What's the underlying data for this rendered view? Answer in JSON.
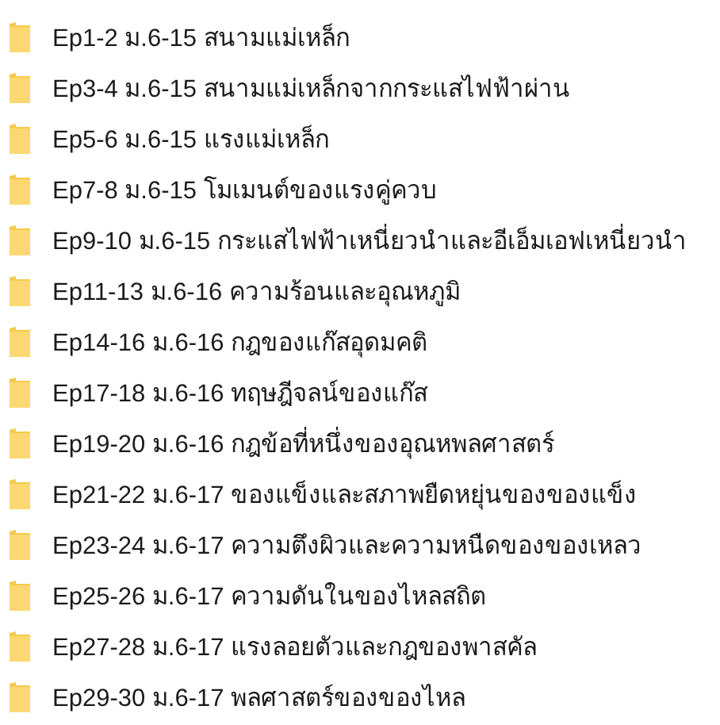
{
  "folders": [
    {
      "name": "Ep1-2 ม.6-15 สนามแม่เหล็ก"
    },
    {
      "name": "Ep3-4 ม.6-15 สนามแม่เหล็กจากกระแสไฟฟ้าผ่าน"
    },
    {
      "name": "Ep5-6 ม.6-15 แรงแม่เหล็ก"
    },
    {
      "name": "Ep7-8 ม.6-15 โมเมนต์ของแรงคู่ควบ"
    },
    {
      "name": "Ep9-10 ม.6-15 กระแสไฟฟ้าเหนี่ยวนำและอีเอ็มเอฟเหนี่ยวนำ"
    },
    {
      "name": "Ep11-13 ม.6-16 ความร้อนและอุณหภูมิ"
    },
    {
      "name": "Ep14-16 ม.6-16 กฎของแก๊สอุดมคติ"
    },
    {
      "name": "Ep17-18 ม.6-16 ทฤษฎีจลน์ของแก๊ส"
    },
    {
      "name": "Ep19-20 ม.6-16 กฎข้อที่หนึ่งของอุณหพลศาสตร์"
    },
    {
      "name": "Ep21-22 ม.6-17 ของแข็งและสภาพยืดหยุ่นของของแข็ง"
    },
    {
      "name": "Ep23-24 ม.6-17 ความตึงผิวและความหนืดของของเหลว"
    },
    {
      "name": "Ep25-26 ม.6-17 ความดันในของไหลสถิต"
    },
    {
      "name": "Ep27-28 ม.6-17 แรงลอยตัวและกฎของพาสคัล"
    },
    {
      "name": "Ep29-30 ม.6-17 พลศาสตร์ของของไหล"
    }
  ]
}
